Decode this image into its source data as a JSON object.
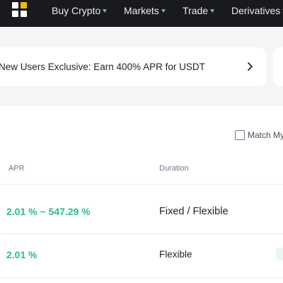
{
  "nav": {
    "items": [
      {
        "label": "Buy Crypto",
        "has_dropdown": true
      },
      {
        "label": "Markets",
        "has_dropdown": true
      },
      {
        "label": "Trade",
        "has_dropdown": true
      },
      {
        "label": "Derivatives",
        "has_dropdown": true
      }
    ]
  },
  "promo": {
    "text": "New Users Exclusive: Earn 400% APR for USDT"
  },
  "filters": {
    "match_label": "Match My"
  },
  "table": {
    "columns": [
      "APR",
      "Duration"
    ],
    "rows": [
      {
        "apr": "2.01 % ~ 547.29 %",
        "duration": "Fixed / Flexible"
      },
      {
        "apr": "2.01 %",
        "duration": "Flexible"
      }
    ]
  },
  "colors": {
    "navbar": "#181a20",
    "accent_green": "#2ebd85",
    "brand_yellow": "#f0b90b",
    "page_bg": "#f5f5f5"
  }
}
